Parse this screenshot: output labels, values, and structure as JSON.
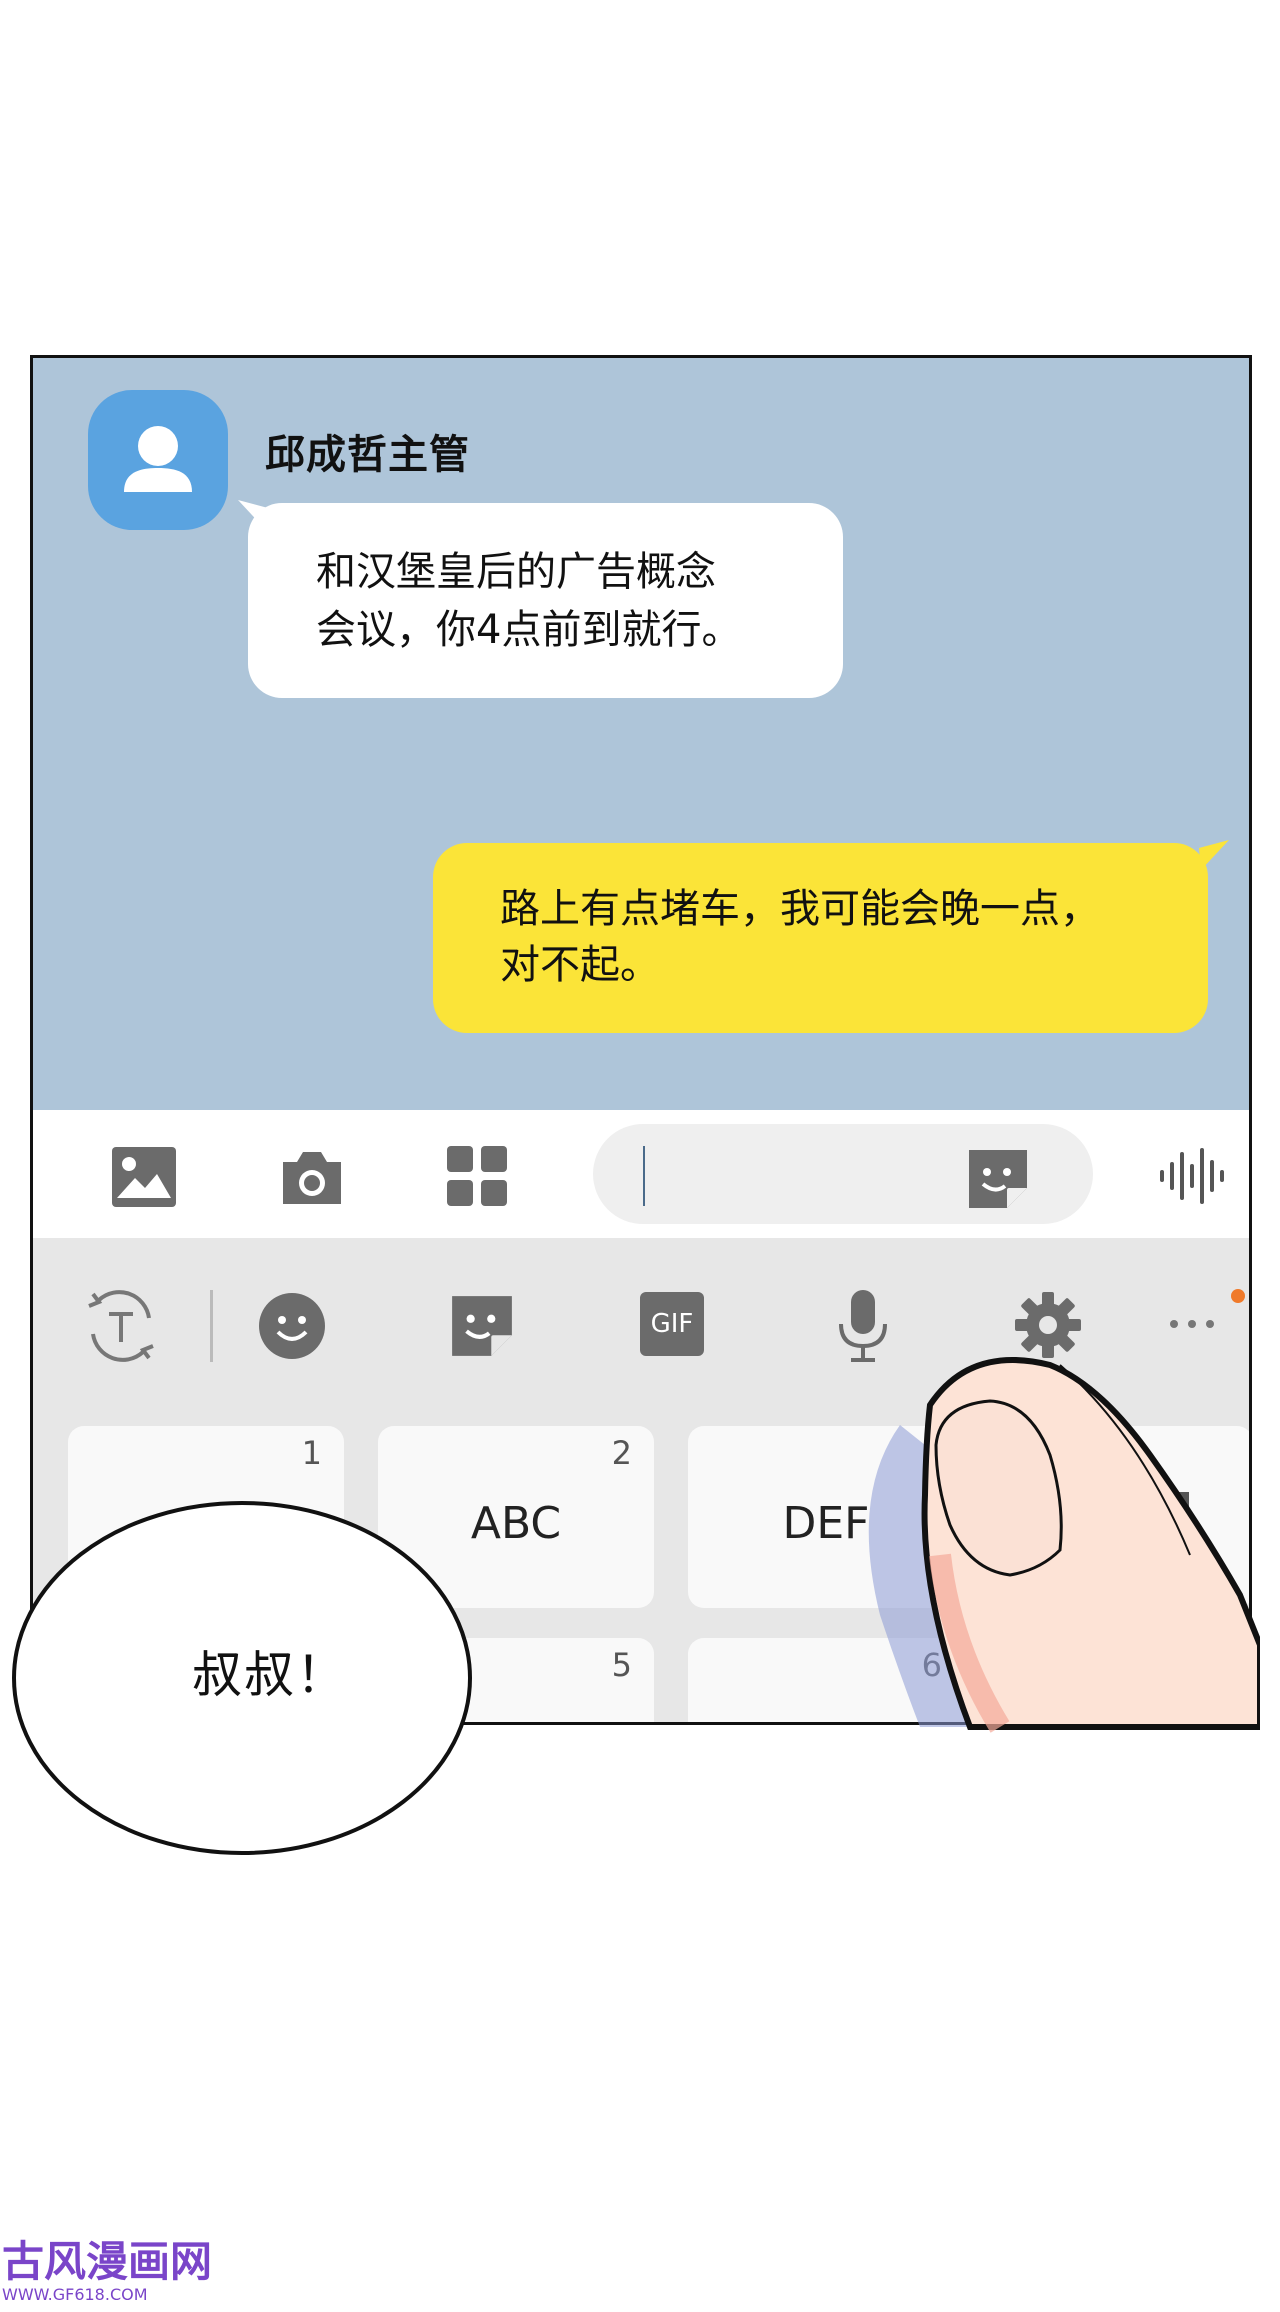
{
  "chat": {
    "sender_name": "邱成哲主管",
    "incoming_message": "和汉堡皇后的广告概念\n会议，你4点前到就行。",
    "outgoing_message": "路上有点堵车，我可能会晚一点，\n对不起。"
  },
  "input_bar": {
    "icons": [
      "image-icon",
      "camera-icon",
      "apps-grid-icon",
      "sticker-icon",
      "voice-wave-icon"
    ],
    "text_value": ""
  },
  "keyboard": {
    "toolbar_icons": [
      "text-translate-icon",
      "emoji-icon",
      "sticker-icon",
      "gif-icon",
      "microphone-icon",
      "settings-gear-icon",
      "more-icon"
    ],
    "gif_label": "GIF",
    "keys": [
      {
        "num": "1",
        "label": ""
      },
      {
        "num": "2",
        "label": "ABC"
      },
      {
        "num": "3",
        "label": "DEF"
      },
      {
        "num": "5",
        "label": ""
      },
      {
        "num": "6",
        "label": ""
      }
    ],
    "notification_dot_color": "#f07a2a"
  },
  "speech_balloon": {
    "text": "叔叔！"
  },
  "colors": {
    "chat_background": "#aec5d9",
    "outgoing_bubble": "#fbe438",
    "avatar": "#5aa3e0"
  },
  "watermark": {
    "title": "古风漫画网",
    "url": "WWW.GF618.COM"
  }
}
